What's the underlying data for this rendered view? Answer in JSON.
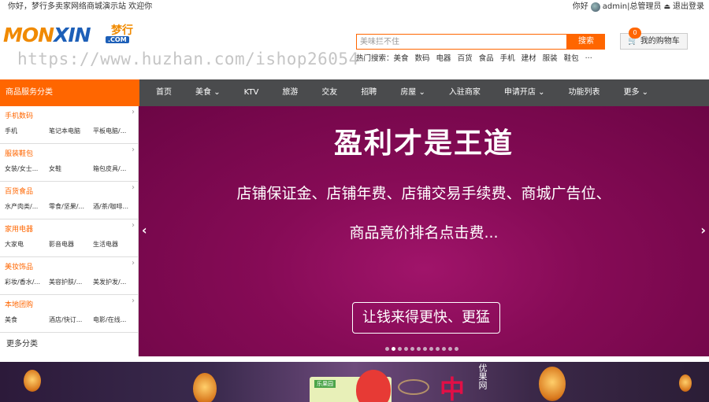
{
  "topbar": {
    "greeting": "你好，梦行多卖家网络商城演示站 欢迎你",
    "user_prefix": "你好",
    "username": "admin|总管理员",
    "logout": "退出登录"
  },
  "logo": {
    "mon": "MON",
    "xin": "XIN",
    "cn": "梦行",
    "com": ".COM"
  },
  "watermark": "https://www.huzhan.com/ishop26054",
  "search": {
    "placeholder": "美味拦不住",
    "button": "搜索"
  },
  "hot_search": {
    "label": "热门搜索：",
    "items": [
      "美食",
      "数码",
      "电器",
      "百货",
      "食品",
      "手机",
      "建材",
      "服装",
      "鞋包",
      "..."
    ]
  },
  "cart": {
    "count": "0",
    "label": "我的购物车",
    "icon": "cart-icon"
  },
  "nav": {
    "category_label": "商品服务分类",
    "items": [
      "首页",
      "美食",
      "KTV",
      "旅游",
      "交友",
      "招聘",
      "房屋",
      "入驻商家",
      "申请开店",
      "功能列表",
      "更多"
    ]
  },
  "sidebar": {
    "categories": [
      {
        "title": "手机数码",
        "subs": [
          "手机",
          "笔记本电脑",
          "平板电脑/..."
        ]
      },
      {
        "title": "服装鞋包",
        "subs": [
          "女装/女士...",
          "女鞋",
          "箱包皮具/..."
        ]
      },
      {
        "title": "百货食品",
        "subs": [
          "水产肉类/...",
          "零食/坚果/...",
          "酒/茶/咖啡..."
        ]
      },
      {
        "title": "家用电器",
        "subs": [
          "大家电",
          "影音电器",
          "生活电器"
        ]
      },
      {
        "title": "美妆饰品",
        "subs": [
          "彩妆/香水/...",
          "美容护肤/...",
          "美发护发/..."
        ]
      },
      {
        "title": "本地团购",
        "subs": [
          "美食",
          "酒店/快订...",
          "电影/在线..."
        ]
      }
    ],
    "more": "更多分类"
  },
  "banner": {
    "title": "盈利才是王道",
    "line1": "店铺保证金、店铺年费、店铺交易手续费、商城广告位、",
    "line2": "商品竟价排名点击费...",
    "button": "让钱来得更快、更猛",
    "prev": "‹",
    "next": "›",
    "slide_count": 12,
    "active_slide": 2
  },
  "promo": {
    "card_tag": "乐果园",
    "big_char": "中",
    "brand": "优果网"
  }
}
